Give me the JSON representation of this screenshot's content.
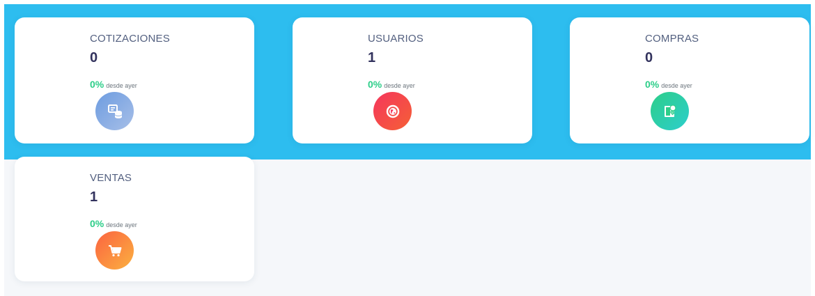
{
  "cards": [
    {
      "title": "COTIZACIONES",
      "value": "0",
      "percent": "0%",
      "since": "desde ayer",
      "icon": "quotes-icon",
      "color": "#8fb0e4"
    },
    {
      "title": "USUARIOS",
      "value": "1",
      "percent": "0%",
      "since": "desde ayer",
      "icon": "globe-icon",
      "color": "#f5365c"
    },
    {
      "title": "COMPRAS",
      "value": "0",
      "percent": "0%",
      "since": "desde ayer",
      "icon": "purchases-icon",
      "color": "#2dce89"
    },
    {
      "title": "VENTAS",
      "value": "1",
      "percent": "0%",
      "since": "desde ayer",
      "icon": "cart-icon",
      "color": "#fb6340"
    }
  ],
  "colors": {
    "banner": "#2dbdef",
    "background": "#f5f7fa",
    "positive": "#2dce89"
  }
}
